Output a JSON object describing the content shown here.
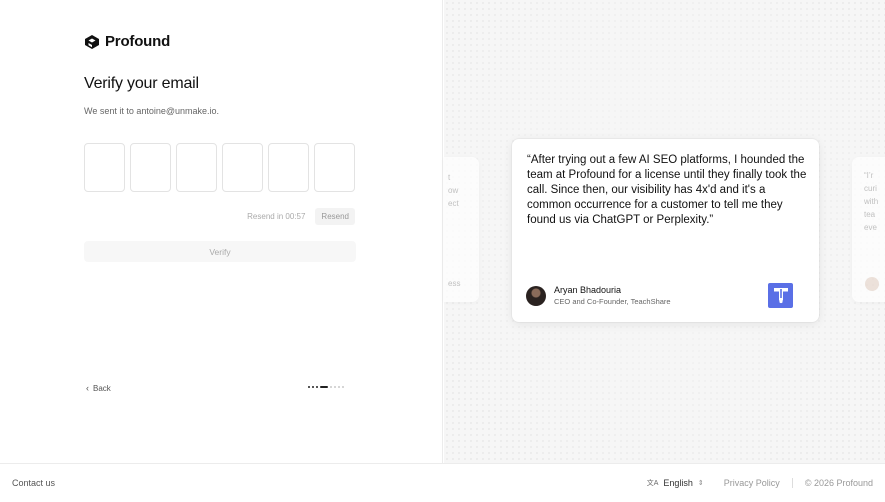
{
  "brand": {
    "name": "Profound"
  },
  "verify": {
    "title": "Verify your email",
    "subtitle": "We sent it to antoine@unmake.io.",
    "code_digits": [
      "",
      "",
      "",
      "",
      "",
      ""
    ],
    "resend_timer": "Resend in 00:57",
    "resend_label": "Resend",
    "verify_label": "Verify",
    "back_label": "Back",
    "progress": {
      "completed_steps": 3,
      "current_step": 4,
      "total_steps": 8
    }
  },
  "testimonial": {
    "quote": "“After trying out a few AI SEO platforms, I hounded the team at Profound for a license until they finally took the call. Since then, our visibility has 4x'd and it's a common occurrence for a customer to tell me they found us via ChatGPT or Perplexity.”",
    "author_name": "Aryan Bhadouria",
    "author_role": "CEO and Co-Founder, TeachShare",
    "company_logo_color": "#5a6fe6",
    "left_peek_lines": [
      "t",
      "ow",
      "",
      "ect",
      "",
      "",
      "",
      "",
      "ess"
    ],
    "right_peek_lines": [
      "“I’r",
      "curi",
      "with",
      "tea",
      "eve"
    ]
  },
  "footer": {
    "contact": "Contact us",
    "language": "English",
    "privacy": "Privacy Policy",
    "copyright": "© 2026 Profound"
  },
  "colors": {
    "accent": "#5a6fe6",
    "text": "#111111",
    "muted": "#999999"
  }
}
